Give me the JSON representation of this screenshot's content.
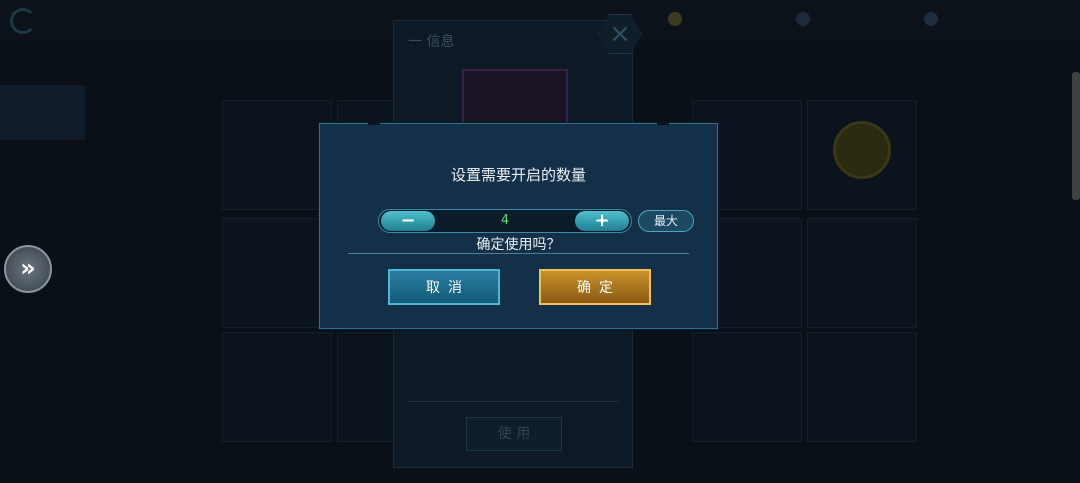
{
  "background": {
    "top_bar": {
      "title": "",
      "dim_text": ""
    },
    "resources": [
      {
        "icon": "gold-coin-icon",
        "value": ""
      },
      {
        "icon": "gem-icon",
        "value": ""
      },
      {
        "icon": "energy-icon",
        "value": ""
      }
    ],
    "side_nav": [
      "",
      "",
      "",
      ""
    ],
    "info_panel": {
      "header": "一 信息",
      "use_label": "使 用"
    }
  },
  "modal": {
    "title": "设置需要开启的数量",
    "stepper": {
      "minus_label": "−",
      "plus_label": "+",
      "value": "4"
    },
    "max_label": "最大",
    "confirm_question": "确定使用吗？",
    "cancel_label": "取消",
    "ok_label": "确定"
  },
  "colors": {
    "modal_bg": "#143049",
    "cancel_btn": "#2a7ea0",
    "ok_btn": "#c9922a",
    "qty_text": "#52e07a"
  }
}
